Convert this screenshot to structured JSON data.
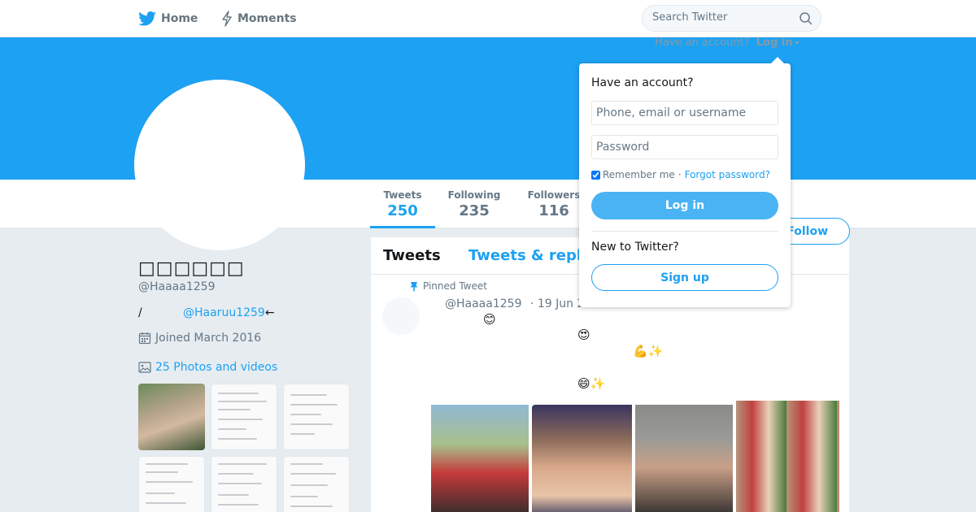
{
  "nav": {
    "home_label": "Home",
    "moments_label": "Moments",
    "search_placeholder": "Search Twitter"
  },
  "account_prompt": {
    "text": "Have an account?",
    "login_label": "Log in"
  },
  "profile": {
    "display_name": "□□□□□□",
    "screen_name": "@Haaaa1259",
    "bio_prefix": "/",
    "bio_mention": "@Haaruu1259",
    "bio_suffix": "←",
    "joined": "Joined March 2016",
    "photos_link": "25 Photos and videos"
  },
  "stats": {
    "tweets_label": "Tweets",
    "tweets_value": "250",
    "following_label": "Following",
    "following_value": "235",
    "followers_label": "Followers",
    "followers_value": "116"
  },
  "follow_button": "Follow",
  "timeline": {
    "tab_tweets": "Tweets",
    "tab_replies": "Tweets & repl",
    "pinned_label": "Pinned Tweet",
    "tweet_handle": "@Haaaa1259",
    "tweet_date": "· 19 Jun 2019",
    "emojis": [
      "😊",
      "😍",
      "💪✨",
      "😄✨"
    ]
  },
  "login_dropdown": {
    "title": "Have an account?",
    "phone_placeholder": "Phone, email or username",
    "password_placeholder": "Password",
    "remember_label": "Remember me",
    "separator": "·",
    "forgot_label": "Forgot password?",
    "login_button": "Log in",
    "new_label": "New to Twitter?",
    "signup_button": "Sign up"
  },
  "colors": {
    "accent": "#1da1f2",
    "banner": "#1da1f2",
    "background": "#e6ecf0"
  },
  "icons": [
    "twitter-bird-icon",
    "lightning-icon",
    "search-icon",
    "calendar-icon",
    "image-icon",
    "pin-icon"
  ]
}
